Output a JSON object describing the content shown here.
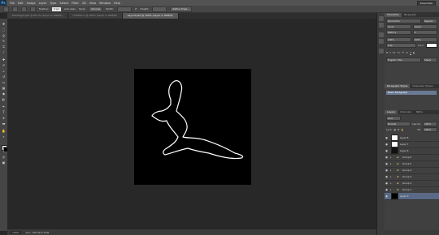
{
  "menubar": {
    "logo": "Ps",
    "items": [
      "File",
      "Edit",
      "Image",
      "Layer",
      "Type",
      "Select",
      "Filter",
      "3D",
      "View",
      "Window",
      "Help"
    ],
    "workspace": "Essentials"
  },
  "options": {
    "feather_label": "Feather:",
    "feather_value": "0 px",
    "antialias_label": "Anti-alias",
    "style_label": "Style:",
    "style_value": "Normal",
    "width_label": "Width:",
    "height_label": "Height:",
    "refine_label": "Refine Edge..."
  },
  "tabs": [
    {
      "label": "Rectangle.psd @ 66.7% (Layer 4, RGB/8)",
      "active": false
    },
    {
      "label": "Untitled-1 @ 100% (Layer 4, RGB/8)",
      "active": false
    },
    {
      "label": "Layout.psd @ 100% (Layer 4, RGB/8)",
      "active": true
    }
  ],
  "status": {
    "zoom": "100%",
    "doc": "Doc: 768.4K/3.00M"
  },
  "character": {
    "tabs": [
      "Character",
      "Paragraph"
    ],
    "font": "Myriad Pro",
    "font_style": "Regular",
    "size": "12 pt",
    "leading": "(Auto)",
    "kerning": "Metrics",
    "tracking": "0",
    "vscale": "100%",
    "hscale": "100%",
    "baseline": "0 pt",
    "color_label": "Color:",
    "language": "English: USA",
    "aa": "Sharp"
  },
  "para_styles": {
    "tabs": [
      "Paragraph Styles",
      "Character Styles"
    ],
    "item": "Basic Paragraph"
  },
  "layers": {
    "tabs": [
      "Layers",
      "Channels",
      "Paths"
    ],
    "kind": "Kind",
    "blend": "Normal",
    "opacity_label": "Opacity:",
    "opacity": "100%",
    "lock_label": "Lock:",
    "fill_label": "Fill:",
    "fill": "100%",
    "rows": [
      {
        "name": "Layer 8",
        "kind": "layer",
        "thumb": "white"
      },
      {
        "name": "Layer 7",
        "kind": "layer",
        "thumb": "figure"
      },
      {
        "name": "Layer 6",
        "kind": "layer",
        "thumb": "figure"
      },
      {
        "name": "Group 6",
        "kind": "group"
      },
      {
        "name": "Group 5",
        "kind": "group"
      },
      {
        "name": "Group 4",
        "kind": "group"
      },
      {
        "name": "Group 3",
        "kind": "group"
      },
      {
        "name": "Group 2",
        "kind": "group"
      },
      {
        "name": "Group 1",
        "kind": "group"
      },
      {
        "name": "Layer 0",
        "kind": "layer",
        "thumb": "black",
        "selected": true
      }
    ]
  },
  "colors": {
    "foreground": "#ffffff",
    "background": "#000000",
    "selection": "#5a6a86"
  }
}
